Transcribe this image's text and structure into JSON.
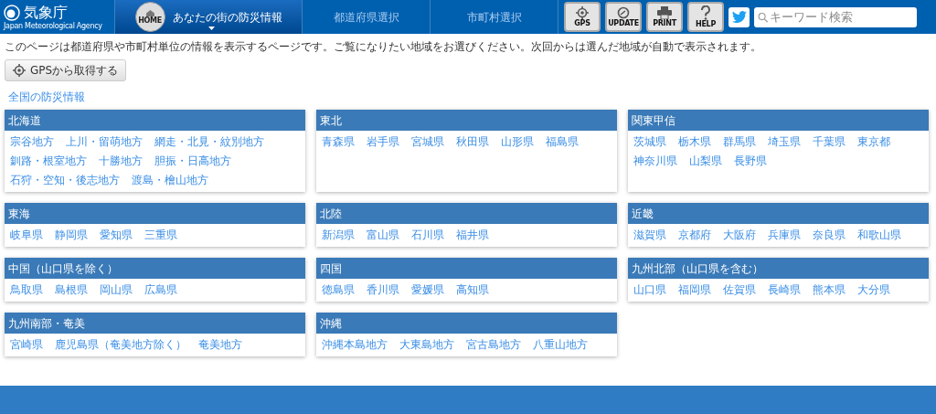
{
  "header": {
    "logo": {
      "name": "気象庁",
      "subtitle": "Japan Meteorological Agency"
    },
    "tabs": [
      {
        "label": "あなたの街の防災情報",
        "icon_label": "HOME",
        "selected": true
      },
      {
        "label": "都道府県選択",
        "selected": false
      },
      {
        "label": "市町村選択",
        "selected": false
      }
    ],
    "tools": [
      {
        "kind": "gps",
        "label": "GPS"
      },
      {
        "kind": "update",
        "label": "UPDATE"
      },
      {
        "kind": "print",
        "label": "PRINT"
      },
      {
        "kind": "help",
        "label": "HELP"
      }
    ],
    "search": {
      "placeholder": "キーワード検索"
    }
  },
  "intro": "このページは都道府県や市町村単位の情報を表示するページです。ご覧になりたい地域をお選びください。次回からは選んだ地域が自動で表示されます。",
  "gps_button": "GPSから取得する",
  "national_link": "全国の防災情報",
  "regions": [
    {
      "title": "北海道",
      "areas": [
        "宗谷地方",
        "上川・留萌地方",
        "網走・北見・紋別地方",
        "釧路・根室地方",
        "十勝地方",
        "胆振・日高地方",
        "石狩・空知・後志地方",
        "渡島・檜山地方"
      ]
    },
    {
      "title": "東北",
      "areas": [
        "青森県",
        "岩手県",
        "宮城県",
        "秋田県",
        "山形県",
        "福島県"
      ]
    },
    {
      "title": "関東甲信",
      "areas": [
        "茨城県",
        "栃木県",
        "群馬県",
        "埼玉県",
        "千葉県",
        "東京都",
        "神奈川県",
        "山梨県",
        "長野県"
      ]
    },
    {
      "title": "東海",
      "areas": [
        "岐阜県",
        "静岡県",
        "愛知県",
        "三重県"
      ]
    },
    {
      "title": "北陸",
      "areas": [
        "新潟県",
        "富山県",
        "石川県",
        "福井県"
      ]
    },
    {
      "title": "近畿",
      "areas": [
        "滋賀県",
        "京都府",
        "大阪府",
        "兵庫県",
        "奈良県",
        "和歌山県"
      ]
    },
    {
      "title": "中国（山口県を除く）",
      "areas": [
        "鳥取県",
        "島根県",
        "岡山県",
        "広島県"
      ]
    },
    {
      "title": "四国",
      "areas": [
        "徳島県",
        "香川県",
        "愛媛県",
        "高知県"
      ]
    },
    {
      "title": "九州北部（山口県を含む）",
      "areas": [
        "山口県",
        "福岡県",
        "佐賀県",
        "長崎県",
        "熊本県",
        "大分県"
      ]
    },
    {
      "title": "九州南部・奄美",
      "areas": [
        "宮崎県",
        "鹿児島県（奄美地方除く）",
        "奄美地方"
      ]
    },
    {
      "title": "沖縄",
      "areas": [
        "沖縄本島地方",
        "大東島地方",
        "宮古島地方",
        "八重山地方"
      ]
    }
  ]
}
